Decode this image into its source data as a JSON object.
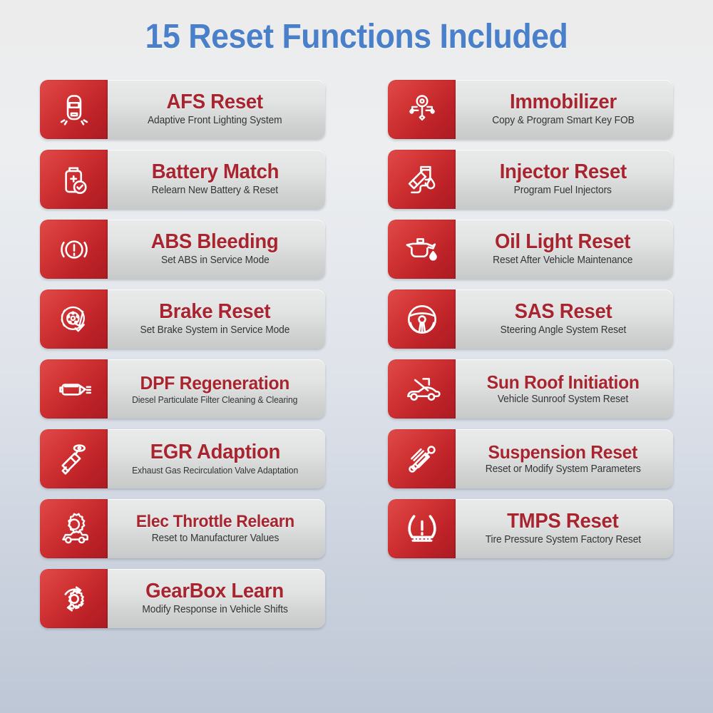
{
  "header": {
    "title": "15 Reset Functions Included",
    "title_color": "#4a80ca"
  },
  "theme": {
    "icon_red_light": "#e04a4a",
    "icon_red_dark": "#ab1c22",
    "card_title_color": "#a82530",
    "card_subtitle_color": "#333437",
    "background_top": "#ececec",
    "background_bottom": "#bec7d6"
  },
  "columns": {
    "left": [
      {
        "icon": "car-headlights-icon",
        "title": "AFS Reset",
        "subtitle": "Adaptive Front Lighting System"
      },
      {
        "icon": "battery-check-icon",
        "title": "Battery Match",
        "subtitle": "Relearn New Battery & Reset"
      },
      {
        "icon": "brake-warning-icon",
        "title": "ABS Bleeding",
        "subtitle": "Set ABS in Service Mode"
      },
      {
        "icon": "brake-disc-icon",
        "title": "Brake Reset",
        "subtitle": "Set Brake System in Service Mode"
      },
      {
        "icon": "exhaust-muffler-icon",
        "title": "DPF Regeneration",
        "subtitle": "Diesel Particulate Filter Cleaning & Clearing"
      },
      {
        "icon": "egr-valve-icon",
        "title": "EGR Adaption",
        "subtitle": "Exhaust Gas Recirculation Valve Adaptation"
      },
      {
        "icon": "car-gear-icon",
        "title": "Elec Throttle Relearn",
        "subtitle": "Reset to Manufacturer Values"
      },
      {
        "icon": "gear-refresh-icon",
        "title": "GearBox Learn",
        "subtitle": "Modify Response in Vehicle Shifts"
      }
    ],
    "right": [
      {
        "icon": "key-circuit-icon",
        "title": "Immobilizer",
        "subtitle": "Copy & Program Smart Key FOB"
      },
      {
        "icon": "fuel-nozzle-icon",
        "title": "Injector Reset",
        "subtitle": "Program Fuel Injectors"
      },
      {
        "icon": "oil-can-icon",
        "title": "Oil Light Reset",
        "subtitle": "Reset After Vehicle Maintenance"
      },
      {
        "icon": "steering-wheel-icon",
        "title": "SAS Reset",
        "subtitle": "Steering Angle  System Reset"
      },
      {
        "icon": "car-sunroof-arrow-icon",
        "title": "Sun Roof Initiation",
        "subtitle": "Vehicle Sunroof System Reset"
      },
      {
        "icon": "shock-absorber-icon",
        "title": "Suspension Reset",
        "subtitle": "Reset or Modify System Parameters"
      },
      {
        "icon": "tire-pressure-icon",
        "title": "TMPS Reset",
        "subtitle": "Tire Pressure System Factory Reset"
      }
    ]
  }
}
